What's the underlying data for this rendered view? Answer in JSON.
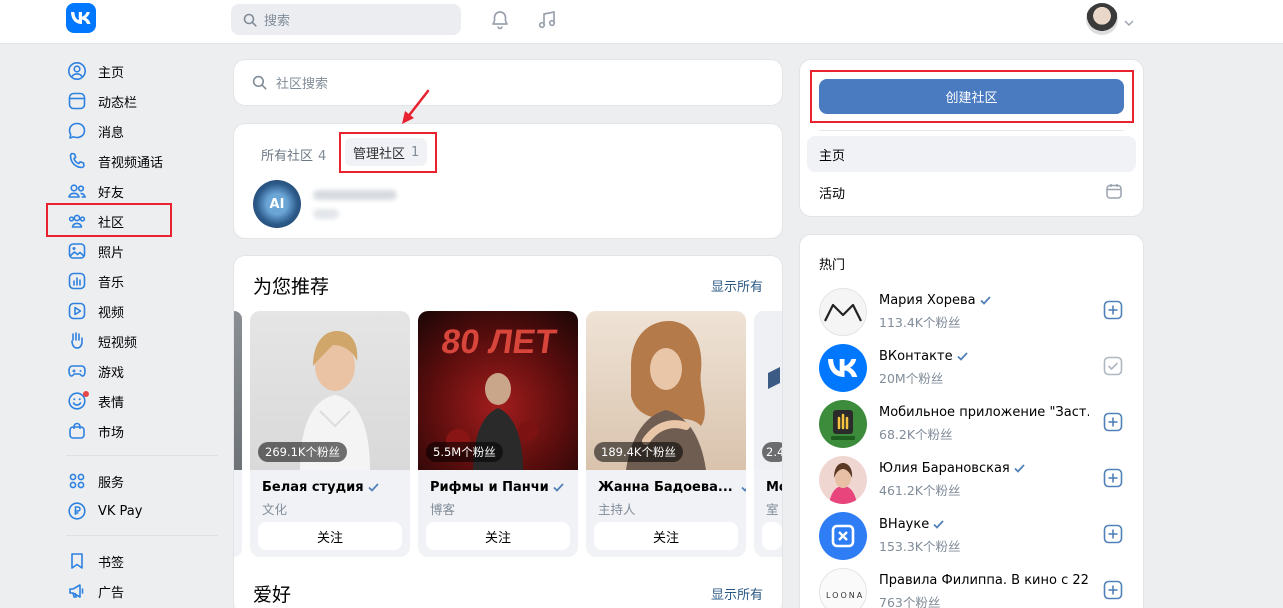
{
  "header": {
    "search_placeholder": "搜索"
  },
  "leftnav": {
    "items": [
      {
        "label": "主页"
      },
      {
        "label": "动态栏"
      },
      {
        "label": "消息"
      },
      {
        "label": "音视频通话"
      },
      {
        "label": "好友"
      },
      {
        "label": "社区"
      },
      {
        "label": "照片"
      },
      {
        "label": "音乐"
      },
      {
        "label": "视频"
      },
      {
        "label": "短视频"
      },
      {
        "label": "游戏"
      },
      {
        "label": "表情"
      },
      {
        "label": "市场"
      },
      {
        "label": "服务"
      },
      {
        "label": "VK Pay"
      },
      {
        "label": "书签"
      },
      {
        "label": "广告"
      }
    ]
  },
  "main": {
    "search_placeholder": "社区搜索",
    "tabs": [
      {
        "label": "所有社区",
        "count": "4"
      },
      {
        "label": "管理社区",
        "count": "1"
      }
    ],
    "managed_group": {
      "avatar_text": "AI"
    },
    "recommended": {
      "title": "为您推荐",
      "show_all": "显示所有",
      "cards": [
        {
          "name": "Белая студия",
          "category": "文化",
          "followers": "269.1K个粉丝",
          "follow": "关注"
        },
        {
          "name": "Рифмы и Панчи",
          "category": "博客",
          "followers": "5.5M个粉丝",
          "follow": "关注"
        },
        {
          "name": "Жанна Бадоева...",
          "category": "主持人",
          "followers": "189.4K个粉丝",
          "follow": "关注"
        }
      ],
      "partial_left": {
        "followers": ""
      },
      "partial_right": {
        "name": "Mo",
        "category": "室",
        "followers": "2.4"
      }
    },
    "hobbies": {
      "title": "爱好",
      "show_all": "显示所有"
    }
  },
  "right": {
    "create_button": "创建社区",
    "menu": [
      {
        "label": "主页"
      },
      {
        "label": "活动"
      }
    ],
    "popular": {
      "title": "热门",
      "items": [
        {
          "name": "Мария Хорева",
          "followers": "113.4K个粉丝",
          "verified": true,
          "state": "add"
        },
        {
          "name": "ВКонтакте",
          "followers": "20M个粉丝",
          "verified": true,
          "state": "added"
        },
        {
          "name": "Мобильное приложение \"Заст...",
          "followers": "68.2K个粉丝",
          "verified": false,
          "state": "add"
        },
        {
          "name": "Юлия Барановская",
          "followers": "461.2K个粉丝",
          "verified": true,
          "state": "add"
        },
        {
          "name": "ВНауке",
          "followers": "153.3K个粉丝",
          "verified": true,
          "state": "add"
        },
        {
          "name": "Правила Филиппа. В кино с 22...",
          "followers": "763个粉丝",
          "verified": false,
          "state": "add"
        }
      ]
    }
  },
  "colors": {
    "accent": "#0077ff",
    "button": "#4a7bc0",
    "link": "#2a5885",
    "annotation": "#e8222f",
    "background": "#edeef0"
  }
}
